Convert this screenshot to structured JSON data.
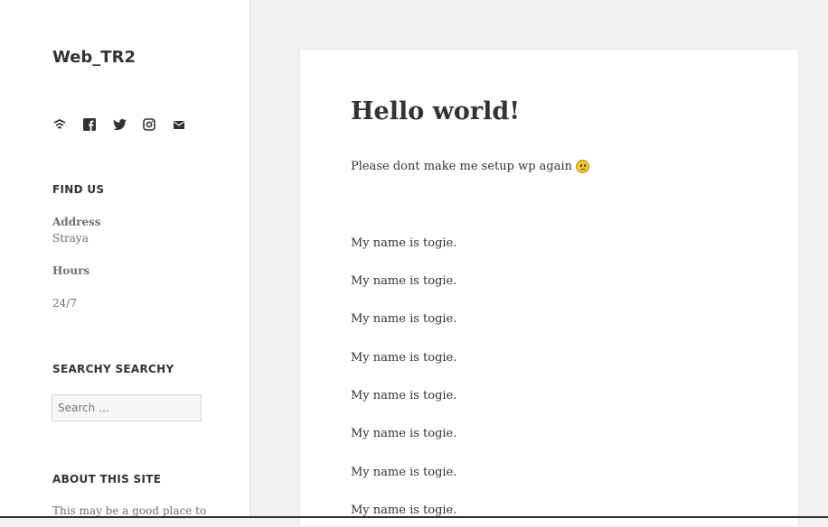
{
  "site": {
    "title": "Web_TR2"
  },
  "social_icons": [
    "wordpress-icon",
    "facebook-icon",
    "twitter-icon",
    "instagram-icon",
    "mail-icon"
  ],
  "find_us": {
    "title": "FIND US",
    "address_label": "Address",
    "address_value": "Straya",
    "hours_label": "Hours",
    "hours_value": "24/7"
  },
  "search_widget": {
    "title": "SEARCHY SEARCHY",
    "placeholder": "Search …"
  },
  "about": {
    "title": "ABOUT THIS SITE",
    "text": "This may be a good place to"
  },
  "post": {
    "title": "Hello world!",
    "intro": "Please dont make me setup wp again",
    "lines": [
      "My name is togie.",
      "My name is togie.",
      "My name is togie.",
      "My name is togie.",
      "My name is togie.",
      "My name is togie.",
      "My name is togie.",
      "My name is togie."
    ]
  }
}
